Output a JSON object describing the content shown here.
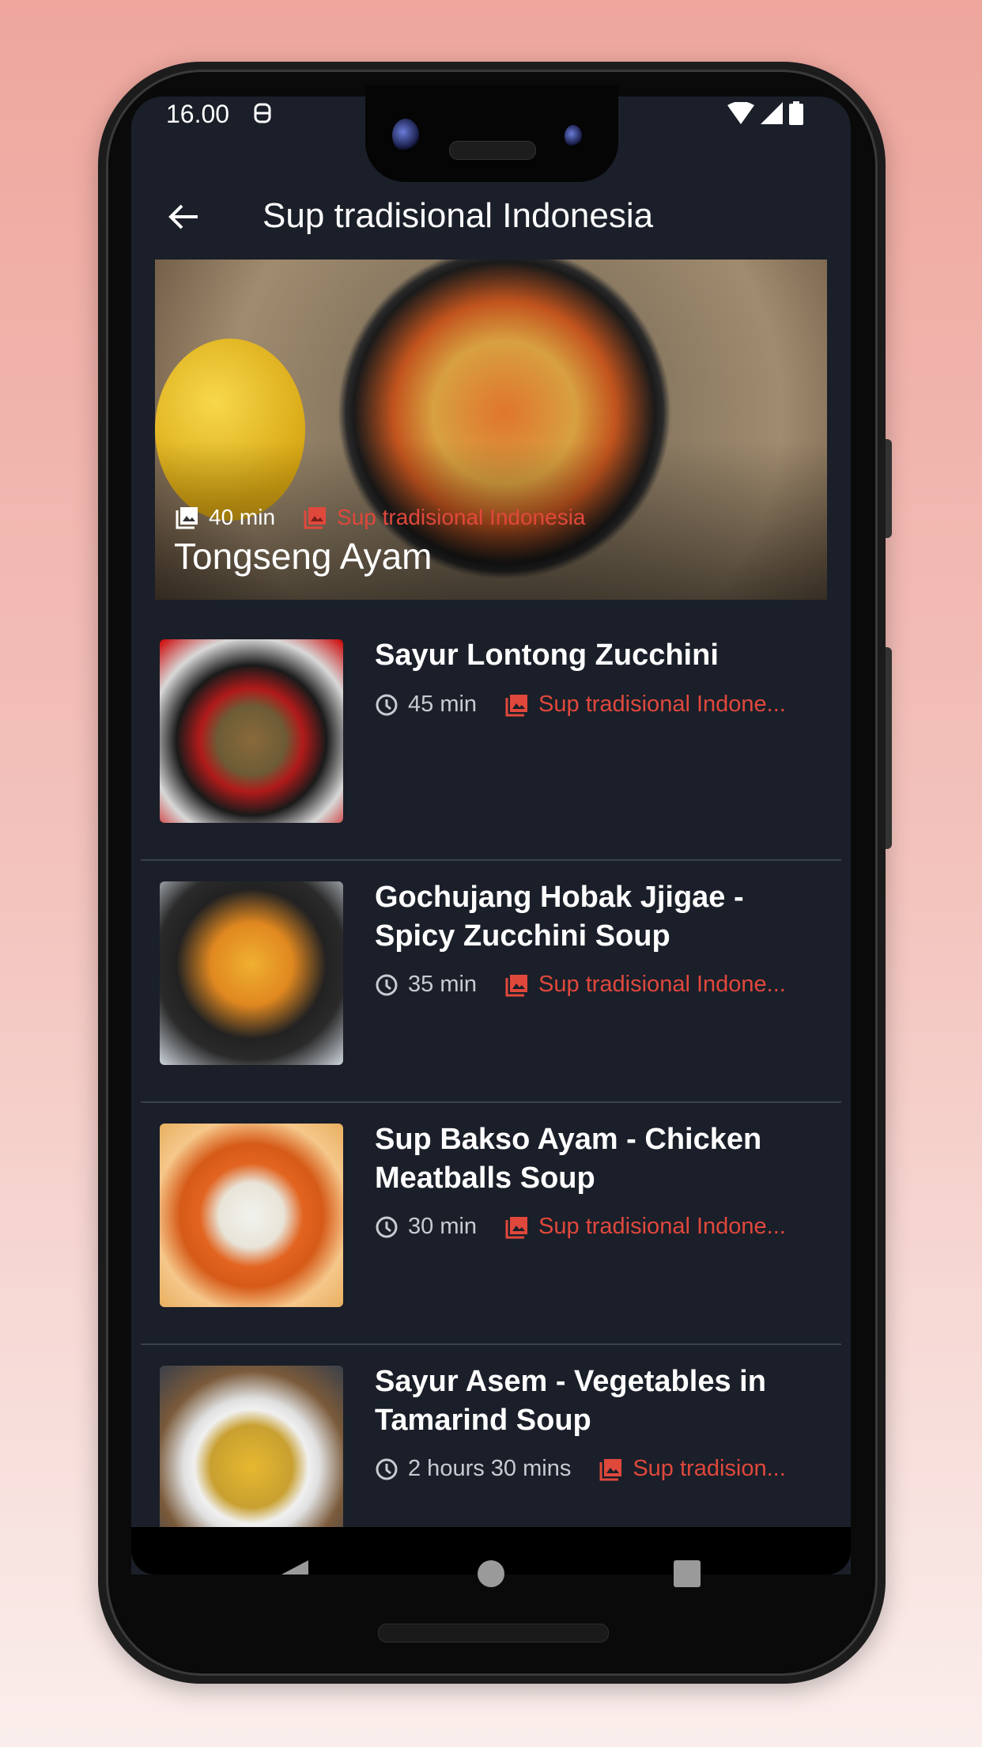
{
  "status_bar": {
    "time": "16.00",
    "left_icons": [
      "dnd-icon"
    ],
    "right_icons": [
      "wifi-icon",
      "signal-icon",
      "battery-icon"
    ]
  },
  "app_bar": {
    "back_icon": "arrow-left-icon",
    "title": "Sup tradisional Indonesia"
  },
  "colors": {
    "background": "#1a1f29",
    "accent": "#e0483c",
    "divider": "#3b414c",
    "secondary_text": "#c8ccd2"
  },
  "featured": {
    "name": "Tongseng Ayam",
    "duration": "40 min",
    "duration_icon": "image-icon",
    "category": "Sup tradisional Indonesia",
    "category_icon": "photo-library-icon"
  },
  "recipes": [
    {
      "name": "Sayur Lontong Zucchini",
      "duration": "45 min",
      "category": "Sup tradisional Indone..."
    },
    {
      "name": "Gochujang Hobak Jjigae - Spicy Zucchini Soup",
      "duration": "35 min",
      "category": "Sup tradisional Indone..."
    },
    {
      "name": "Sup Bakso Ayam - Chicken Meatballs Soup",
      "duration": "30 min",
      "category": "Sup tradisional Indone..."
    },
    {
      "name": "Sayur Asem - Vegetables in Tamarind Soup",
      "duration": "2 hours 30 mins",
      "category": "Sup tradision..."
    }
  ],
  "nav_bar": {
    "buttons": [
      "back",
      "home",
      "recents"
    ]
  }
}
